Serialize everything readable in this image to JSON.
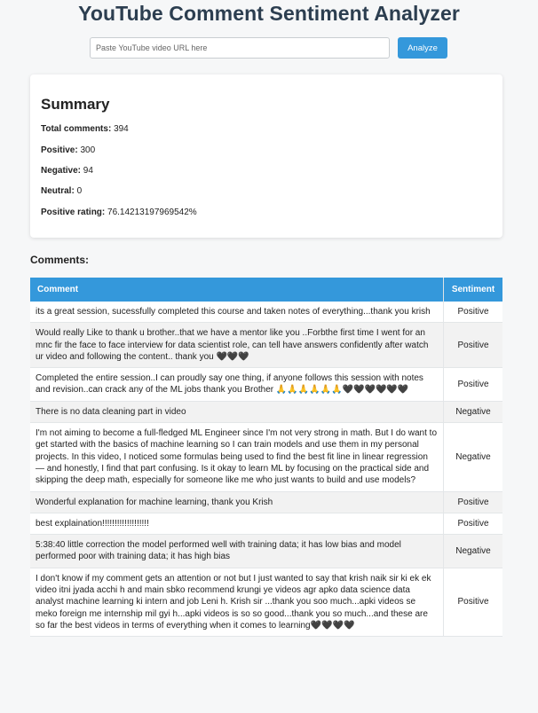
{
  "header": {
    "title": "YouTube Comment Sentiment Analyzer"
  },
  "search": {
    "placeholder": "Paste YouTube video URL here",
    "value": "",
    "button_label": "Analyze"
  },
  "summary": {
    "heading": "Summary",
    "total_label": "Total comments:",
    "total_value": "394",
    "positive_label": "Positive:",
    "positive_value": "300",
    "negative_label": "Negative:",
    "negative_value": "94",
    "neutral_label": "Neutral:",
    "neutral_value": "0",
    "rating_label": "Positive rating:",
    "rating_value": "76.14213197969542%"
  },
  "comments": {
    "heading": "Comments:",
    "columns": [
      "Comment",
      "Sentiment"
    ],
    "rows": [
      {
        "comment": "its a great session, sucessfully completed this course and taken notes of everything...thank you krish",
        "sentiment": "Positive"
      },
      {
        "comment": "Would really Like to thank u brother..that we have a mentor like you ..Forbthe first time I went for an mnc fir the face to face interview for data scientist role, can tell have answers confidently after watch ur video and following the content.. thank you 🖤🖤🖤",
        "sentiment": "Positive"
      },
      {
        "comment": "Completed the entire session..I can proudly say one thing, if anyone follows this session with notes and revision..can crack any of the ML jobs thank you Brother 🙏🙏🙏🙏🙏🙏🖤🖤🖤🖤🖤🖤",
        "sentiment": "Positive"
      },
      {
        "comment": "There is no data cleaning part in video",
        "sentiment": "Negative"
      },
      {
        "comment": "I'm not aiming to become a full-fledged ML Engineer since I'm not very strong in math. But I do want to get started with the basics of machine learning so I can train models and use them in my personal projects. In this video, I noticed some formulas being used to find the best fit line in linear regression — and honestly, I find that part confusing. Is it okay to learn ML by focusing on the practical side and skipping the deep math, especially for someone like me who just wants to build and use models?",
        "sentiment": "Negative"
      },
      {
        "comment": "Wonderful explanation for machine learning, thank you Krish",
        "sentiment": "Positive"
      },
      {
        "comment": "best explaination!!!!!!!!!!!!!!!!!!!",
        "sentiment": "Positive"
      },
      {
        "comment": "5:38:40 little correction the model performed well with training data; it has low bias and model performed poor with training data; it has high bias",
        "sentiment": "Negative"
      },
      {
        "comment": "I don't know if my comment gets an attention or not but I just wanted to say that krish naik sir ki ek ek video itni jyada acchi h and main sbko recommend krungi ye videos agr apko data science data analyst machine learning ki intern and job Leni h. Krish sir ...thank you soo much...apki videos se meko foreign me internship mil gyi h...apki videos is so so good...thank you so much...and these are so far the best videos in terms of everything when it comes to learning🖤🖤🖤🖤",
        "sentiment": "Positive"
      }
    ]
  },
  "colors": {
    "accent": "#3498db",
    "title": "#2c3e50"
  }
}
